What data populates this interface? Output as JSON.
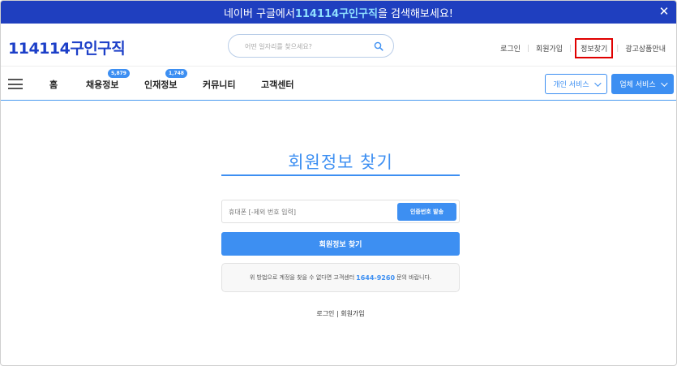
{
  "banner": {
    "prefix": "네이버 구글에서 ",
    "highlight": "114114구인구직",
    "suffix": "을 검색해보세요!",
    "close": "✕"
  },
  "logo": {
    "number": "114114",
    "text": "구인구직"
  },
  "search": {
    "placeholder": "어떤 일자리를 찾으세요?"
  },
  "top_links": {
    "login": "로그인",
    "signup": "회원가입",
    "find_info": "정보찾기",
    "ad_info": "광고상품안내",
    "separator": "|"
  },
  "nav": {
    "home": "홈",
    "jobs": "채용정보",
    "jobs_count": "5,879",
    "talent": "인재정보",
    "talent_count": "1,748",
    "community": "커뮤니티",
    "support": "고객센터",
    "personal_service": "개인 서비스",
    "company_service": "업체 서비스"
  },
  "main": {
    "title": "회원정보 찾기",
    "phone_placeholder": "휴대폰 [-제외 번호 입력]",
    "send_code": "인증번호 발송",
    "find_button": "회원정보 찾기",
    "notice_prefix": "위 방법으로 계정을 찾을 수 없다면 고객센터",
    "notice_phone": "1644-9260",
    "notice_suffix": "문의 바랍니다.",
    "login_link": "로그인",
    "signup_link": "회원가입",
    "link_sep": " | "
  },
  "colors": {
    "brand_blue": "#1f3fbf",
    "accent": "#3d8ff2",
    "highlight_box": "#e00000"
  }
}
